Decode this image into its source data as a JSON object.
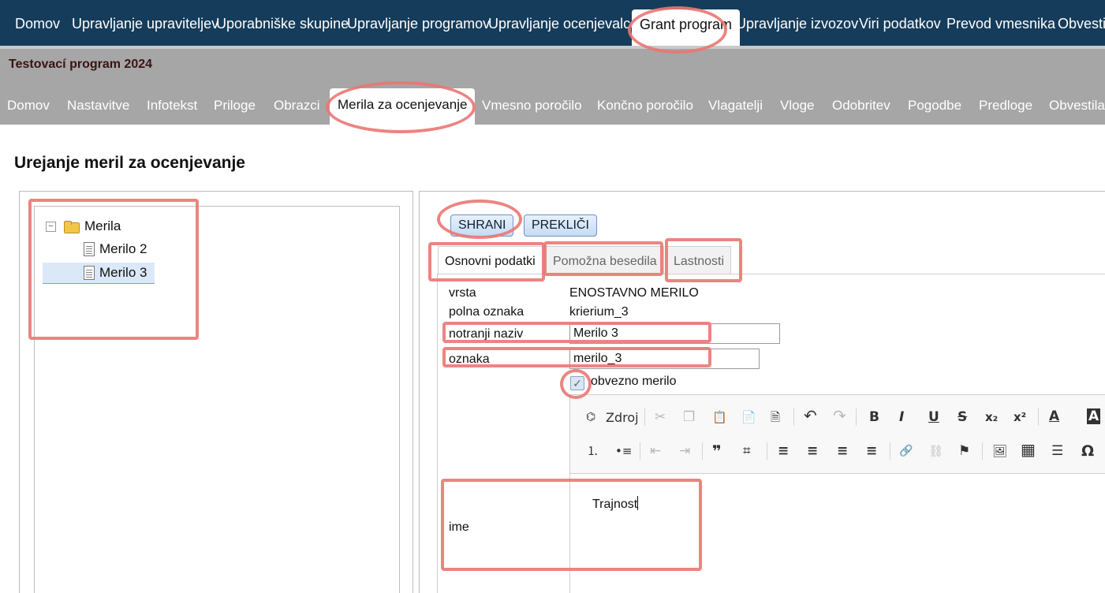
{
  "top_nav": [
    "Domov",
    "Upravljanje upraviteljev",
    "Uporabniške skupine",
    "Upravljanje programov",
    "Upravljanje ocenjevalcev",
    "Grant program",
    "Upravljanje izvozov",
    "Viri podatkov",
    "Prevod vmesnika",
    "Obvestila"
  ],
  "program_title": "Testovací program 2024",
  "sub_nav": [
    "Domov",
    "Nastavitve",
    "Infotekst",
    "Priloge",
    "Obrazci",
    "Merila za ocenjevanje",
    "Vmesno poročilo",
    "Končno poročilo",
    "Vlagatelji",
    "Vloge",
    "Odobritev",
    "Pogodbe",
    "Predloge",
    "Obvestila"
  ],
  "page_title": "Urejanje meril za ocenjevanje",
  "tree": {
    "root": "Merila",
    "children": [
      "Merilo 2",
      "Merilo 3"
    ],
    "selected": "Merilo 3",
    "toggle": "−"
  },
  "buttons": {
    "save": "SHRANI",
    "cancel": "PREKLIČI"
  },
  "tabs": [
    "Osnovni podatki",
    "Pomožna besedila",
    "Lastnosti"
  ],
  "form": {
    "vrsta_label": "vrsta",
    "vrsta_value": "ENOSTAVNO MERILO",
    "polna_label": "polna oznaka",
    "polna_value": "krierium_3",
    "notranji_label": "notranji naziv",
    "notranji_value": "Merilo 3",
    "oznaka_label": "oznaka",
    "oznaka_value": "merilo_3",
    "obvezno_label": "obvezno merilo",
    "obvezno_checked": true,
    "check_mark": "✓",
    "ime_label": "ime",
    "ime_value": "Trajnost"
  },
  "editor": {
    "source_label": "Zdroj",
    "glyphs": {
      "source": "⌬",
      "cut": "✂",
      "copy": "❐",
      "paste": "📋",
      "paste_text": "📄",
      "paste_word": "🗎",
      "undo": "↶",
      "redo": "↷",
      "bold": "B",
      "italic": "I",
      "underline": "U",
      "strike": "S",
      "sub": "x₂",
      "sup": "x²",
      "color": "A",
      "bgcolor": "A",
      "ol": "⒈",
      "ul": "•≡",
      "outdent": "⇤",
      "indent": "⇥",
      "quote": "❞",
      "div": "⌗",
      "left": "≡",
      "center": "≡",
      "right": "≡",
      "justify": "≡",
      "link": "🔗",
      "unlink": "⛓",
      "anchor": "⚑",
      "image": "🖼",
      "table": "▦",
      "hr": "☰",
      "omega": "Ω"
    }
  },
  "colors": {
    "topnav_bg": "#153c5b",
    "progbar_bg": "#a6a6a6",
    "highlight": "#ea7773"
  }
}
